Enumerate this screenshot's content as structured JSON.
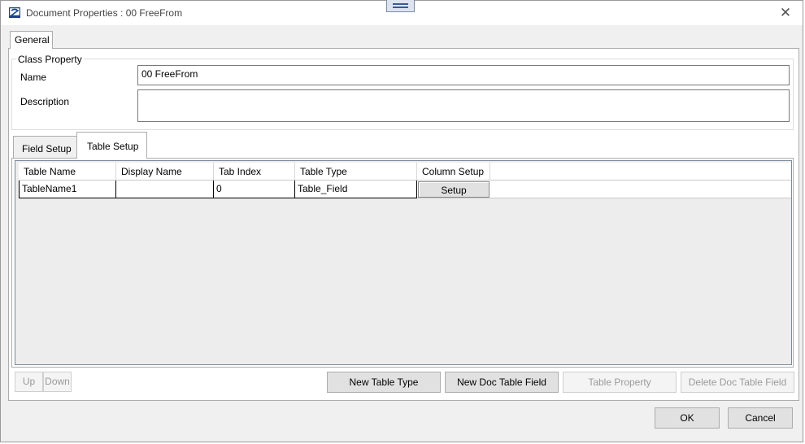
{
  "window": {
    "title": "Document Properties : 00 FreeFrom",
    "close_glyph": "✕",
    "icon": "app-logo-icon"
  },
  "tabs": {
    "general": "General"
  },
  "class_property": {
    "legend": "Class Property",
    "name_label": "Name",
    "name_value": "00 FreeFrom",
    "description_label": "Description",
    "description_value": ""
  },
  "subtabs": {
    "field_setup": "Field Setup",
    "table_setup": "Table Setup"
  },
  "table": {
    "columns": [
      "Table Name",
      "Display Name",
      "Tab Index",
      "Table Type",
      "Column Setup"
    ],
    "rows": [
      {
        "table_name": "TableName1",
        "display_name": "",
        "tab_index": "0",
        "table_type": "Table_Field",
        "column_setup": "Setup"
      }
    ]
  },
  "buttons": {
    "up": "Up",
    "down": "Down",
    "new_table_type": "New Table Type",
    "new_doc_table_field": "New Doc Table Field",
    "table_property": "Table Property",
    "delete_doc_table_field": "Delete Doc Table Field",
    "ok": "OK",
    "cancel": "Cancel"
  }
}
